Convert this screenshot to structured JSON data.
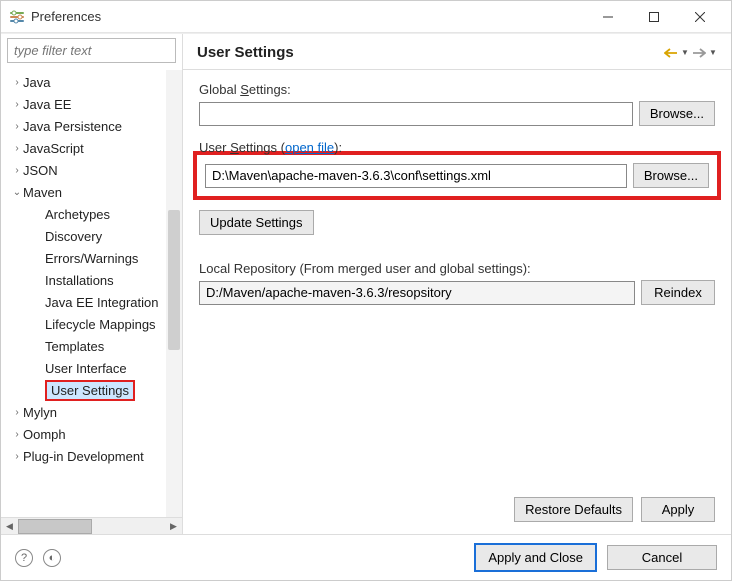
{
  "window": {
    "title": "Preferences"
  },
  "filter": {
    "placeholder": "type filter text"
  },
  "tree": [
    {
      "label": "Java",
      "depth": 0,
      "arrow": ">",
      "expanded": false
    },
    {
      "label": "Java EE",
      "depth": 0,
      "arrow": ">",
      "expanded": false
    },
    {
      "label": "Java Persistence",
      "depth": 0,
      "arrow": ">",
      "expanded": false
    },
    {
      "label": "JavaScript",
      "depth": 0,
      "arrow": ">",
      "expanded": false
    },
    {
      "label": "JSON",
      "depth": 0,
      "arrow": ">",
      "expanded": false
    },
    {
      "label": "Maven",
      "depth": 0,
      "arrow": "v",
      "expanded": true
    },
    {
      "label": "Archetypes",
      "depth": 1,
      "arrow": "",
      "expanded": false
    },
    {
      "label": "Discovery",
      "depth": 1,
      "arrow": "",
      "expanded": false
    },
    {
      "label": "Errors/Warnings",
      "depth": 1,
      "arrow": "",
      "expanded": false
    },
    {
      "label": "Installations",
      "depth": 1,
      "arrow": "",
      "expanded": false
    },
    {
      "label": "Java EE Integration",
      "depth": 1,
      "arrow": "",
      "expanded": false
    },
    {
      "label": "Lifecycle Mappings",
      "depth": 1,
      "arrow": "",
      "expanded": false
    },
    {
      "label": "Templates",
      "depth": 1,
      "arrow": "",
      "expanded": false
    },
    {
      "label": "User Interface",
      "depth": 1,
      "arrow": "",
      "expanded": false
    },
    {
      "label": "User Settings",
      "depth": 1,
      "arrow": "",
      "expanded": false,
      "selected": true
    },
    {
      "label": "Mylyn",
      "depth": 0,
      "arrow": ">",
      "expanded": false
    },
    {
      "label": "Oomph",
      "depth": 0,
      "arrow": ">",
      "expanded": false
    },
    {
      "label": "Plug-in Development",
      "depth": 0,
      "arrow": ">",
      "expanded": false
    }
  ],
  "page": {
    "title": "User Settings",
    "global_label_pre": "Global ",
    "global_label_mn": "S",
    "global_label_post": "ettings:",
    "global_value": "",
    "browse_label": "Browse...",
    "user_label_pre": "User ",
    "user_label_mn": "S",
    "user_label_post": "ettings (",
    "open_file": "open file",
    "user_label_close": "):",
    "user_value": "D:\\Maven\\apache-maven-3.6.3\\conf\\settings.xml",
    "update_label": "Update Settings",
    "local_repo_label": "Local Repository (From merged user and global settings):",
    "local_repo_value": "D:/Maven/apache-maven-3.6.3/resopsitory",
    "reindex_label": "Reindex",
    "restore_label": "Restore Defaults",
    "apply_label": "Apply"
  },
  "footer": {
    "apply_close": "Apply and Close",
    "cancel": "Cancel"
  }
}
